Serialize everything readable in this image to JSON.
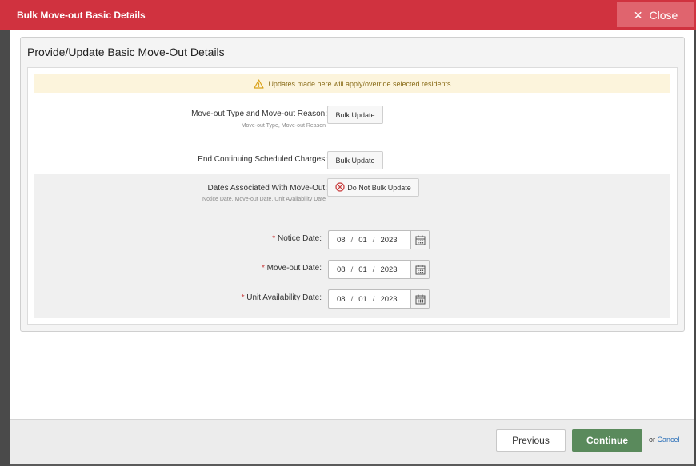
{
  "modal": {
    "title": "Bulk Move-out Basic Details",
    "close_label": "Close"
  },
  "panel": {
    "title": "Provide/Update Basic Move-Out Details",
    "alert": "Updates made here will apply/override selected residents"
  },
  "rows": {
    "move_out_type": {
      "label": "Move-out Type and Move-out Reason:",
      "sub": "Move-out Type, Move-out Reason",
      "button": "Bulk Update"
    },
    "end_charges": {
      "label": "End Continuing Scheduled Charges:",
      "button": "Bulk Update"
    },
    "dates": {
      "label": "Dates Associated With Move-Out:",
      "sub": "Notice Date, Move-out Date, Unit Availability Date",
      "button": "Do Not Bulk Update"
    }
  },
  "date_fields": {
    "notice": {
      "label": "Notice Date:",
      "month": "08",
      "day": "01",
      "year": "2023"
    },
    "move_out": {
      "label": "Move-out Date:",
      "month": "08",
      "day": "01",
      "year": "2023"
    },
    "unit_availability": {
      "label": "Unit Availability Date:",
      "month": "08",
      "day": "01",
      "year": "2023"
    }
  },
  "required_marker": "*",
  "date_separator": "/",
  "footer": {
    "previous_label": "Previous",
    "continue_label": "Continue",
    "or_text": "or",
    "cancel_label": "Cancel"
  },
  "colors": {
    "header": "#d0323f",
    "close_button": "#e0646e",
    "continue_button": "#5a8a5c",
    "alert_bg": "#fcf4dc",
    "cancel_link": "#2a6fb8"
  },
  "icons": {
    "close": "close-x-icon",
    "warning": "warning-triangle-icon",
    "no_update": "circle-x-icon",
    "calendar": "calendar-icon"
  }
}
